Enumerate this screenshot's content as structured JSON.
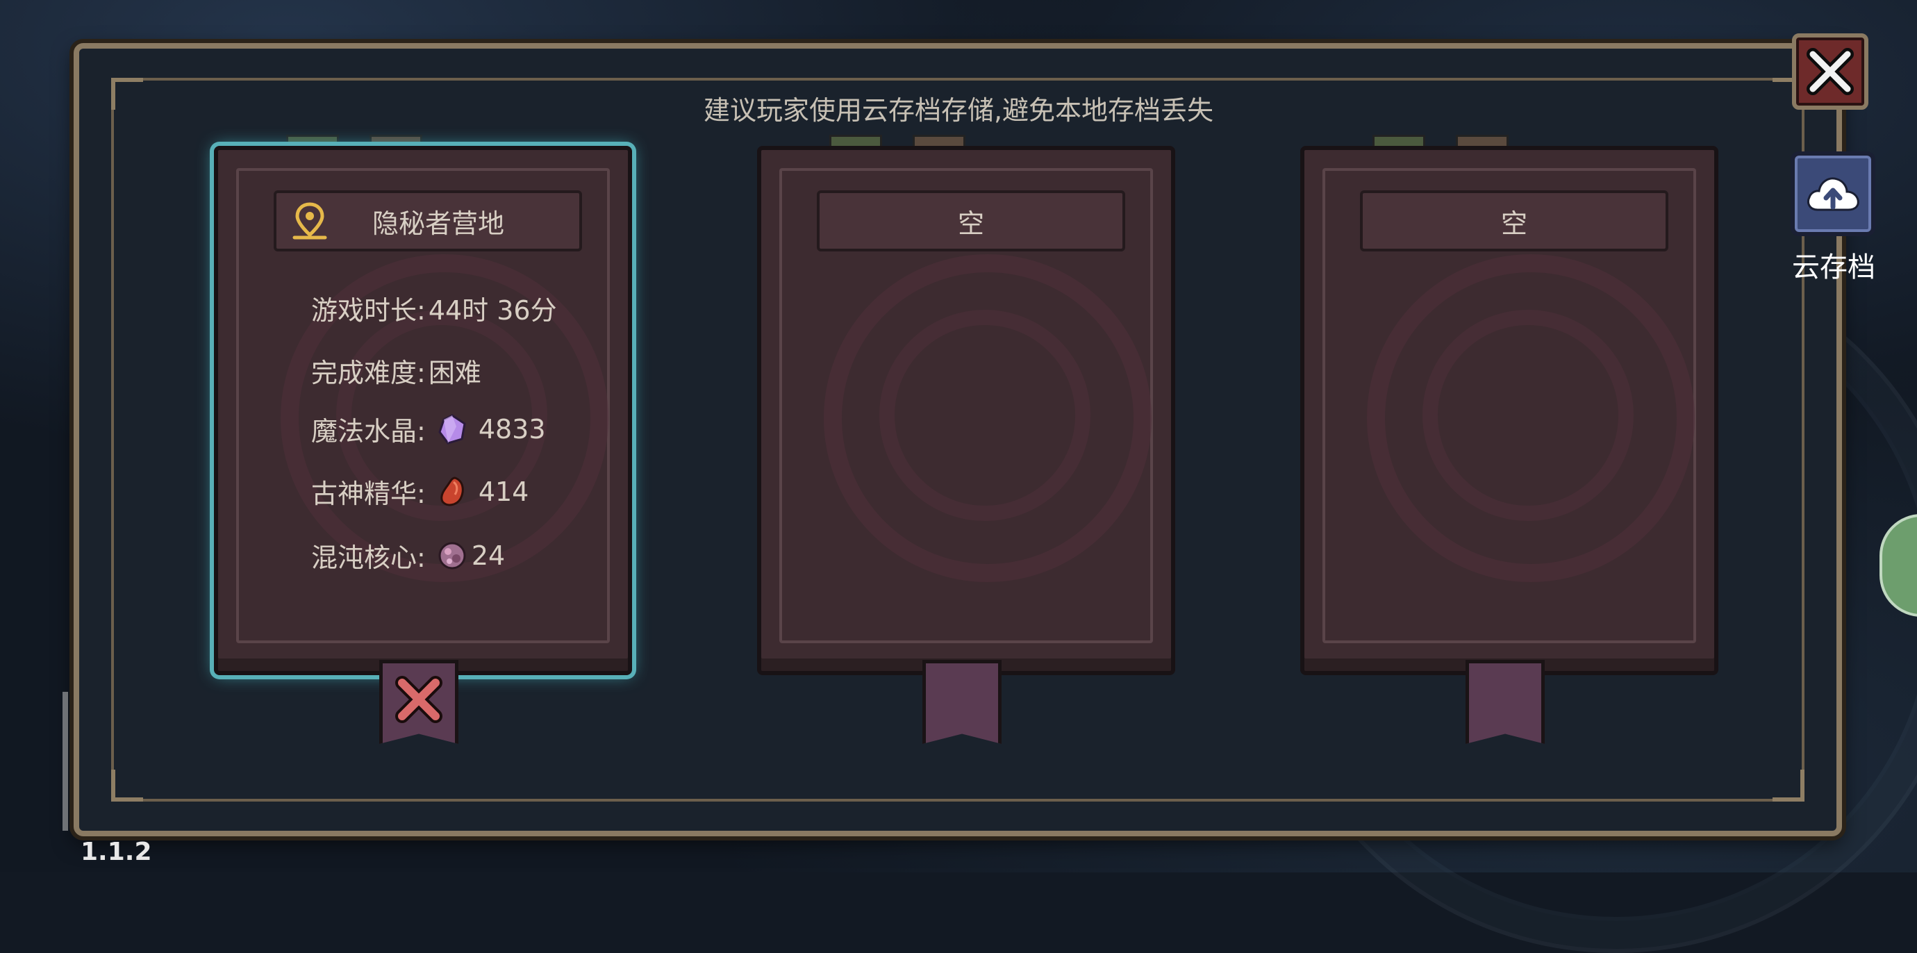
{
  "notice": "建议玩家使用云存档存储,避免本地存档丢失",
  "cloud_button": {
    "label": "云存档",
    "icon": "cloud-upload-icon"
  },
  "close_button": {
    "icon": "close-icon"
  },
  "version": "1.1.2",
  "slots": [
    {
      "title": "隐秘者营地",
      "selected": true,
      "icon": "location-pin-icon",
      "play_time_label": "游戏时长:",
      "play_time_value": "44时 36分",
      "difficulty_label": "完成难度:",
      "difficulty_value": "困难",
      "magic_crystal_label": "魔法水晶:",
      "magic_crystal_value": "4833",
      "ancient_essence_label": "古神精华:",
      "ancient_essence_value": "414",
      "chaos_core_label": "混沌核心:",
      "chaos_core_value": "24"
    },
    {
      "title": "空",
      "selected": false
    },
    {
      "title": "空",
      "selected": false
    }
  ],
  "colors": {
    "selected_glow": "#58b0b8",
    "book": "#3d2b30",
    "delete_x": "#d96a6a",
    "crystal": "#b68be8",
    "essence": "#c9442e",
    "chaos": "#a07090"
  }
}
